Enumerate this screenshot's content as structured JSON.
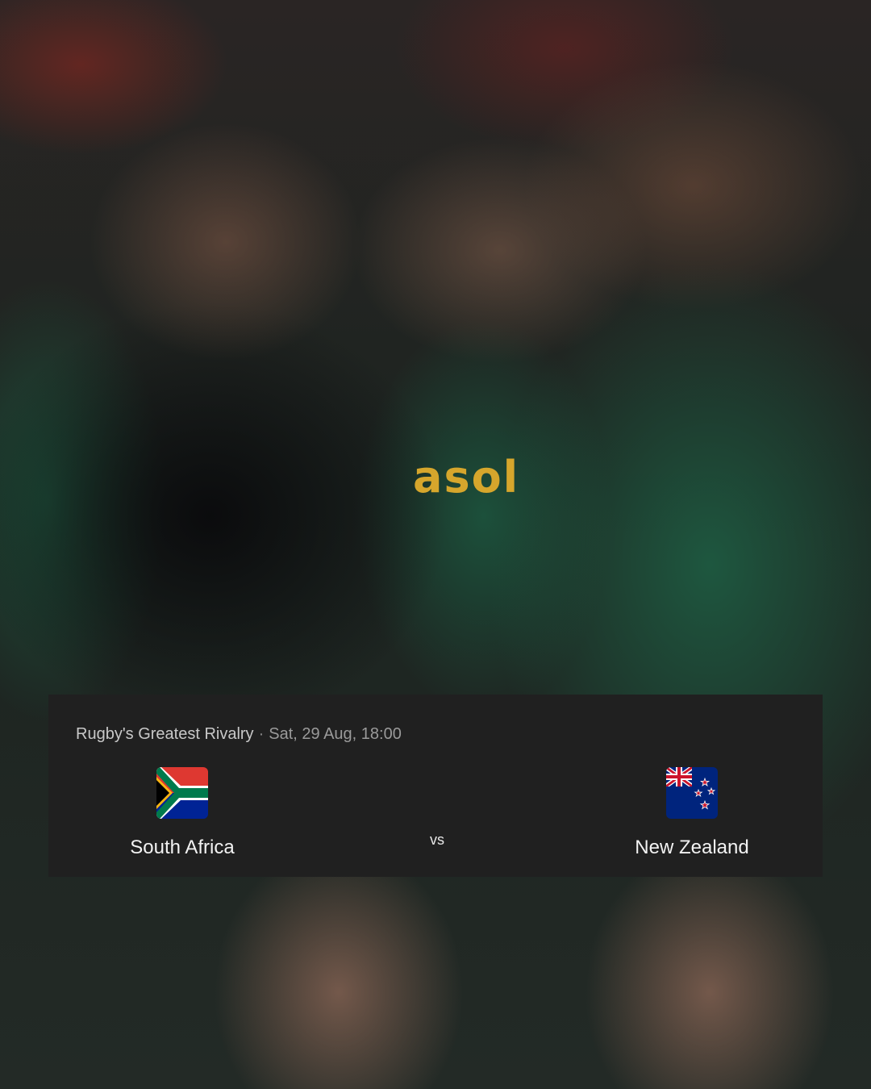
{
  "photo": {
    "sponsor_text": "asol"
  },
  "match": {
    "competition": "Rugby's Greatest Rivalry",
    "separator": "·",
    "datetime": "Sat, 29 Aug, 18:00",
    "vs_label": "vs",
    "home": {
      "name": "South Africa",
      "flag_icon": "south-africa-flag-icon"
    },
    "away": {
      "name": "New Zealand",
      "flag_icon": "new-zealand-flag-icon"
    }
  },
  "colors": {
    "card_background": "#202020",
    "springbok_green": "#1f5c45",
    "gold": "#d6a62c"
  }
}
